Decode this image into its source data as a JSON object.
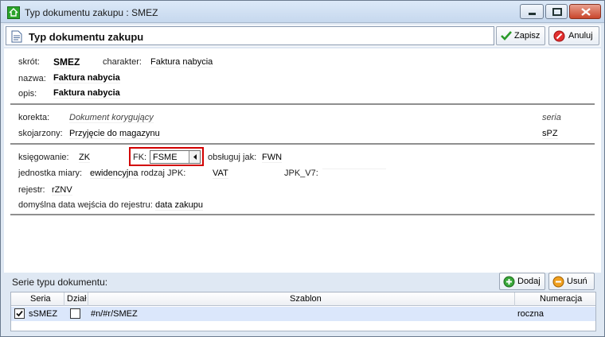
{
  "window": {
    "title": "Typ dokumentu zakupu : SMEZ"
  },
  "header": {
    "title": "Typ dokumentu zakupu",
    "save_label": "Zapisz",
    "cancel_label": "Anuluj"
  },
  "form": {
    "skrot_label": "skrót:",
    "skrot_value": "SMEZ",
    "charakter_label": "charakter:",
    "charakter_value": "Faktura nabycia",
    "nazwa_label": "nazwa:",
    "nazwa_value": "Faktura nabycia",
    "opis_label": "opis:",
    "opis_value": "Faktura nabycia",
    "korekta_label": "korekta:",
    "korekta_value": "Dokument korygujący",
    "seria_label": "seria",
    "skojarzony_label": "skojarzony:",
    "skojarzony_value": "Przyjęcie do magazynu",
    "skojarzony_seria": "sPZ",
    "ksiegowanie_label": "księgowanie:",
    "ksiegowanie_value": "ZK",
    "fk_label": "FK:",
    "fk_value": "FSME",
    "obsluguj_label": "obsługuj jak:",
    "obsluguj_value": "FWN",
    "jednostka_label": "jednostka miary:",
    "jednostka_value": "ewidencyjna",
    "rodzaj_label": "rodzaj JPK:",
    "rodzaj_value": "VAT",
    "jpk_label": "JPK_V7:",
    "jpk_value": "",
    "rejestr_label": "rejestr:",
    "rejestr_value": "rZNV",
    "domyslna_label": "domyślna data wejścia do rejestru:",
    "domyslna_value": "data zakupu"
  },
  "series": {
    "title": "Serie typu dokumentu:",
    "add_label": "Dodaj",
    "remove_label": "Usuń",
    "columns": {
      "seria": "Seria",
      "dzial": "Dział",
      "szablon": "Szablon",
      "numeracja": "Numeracja"
    },
    "rows": [
      {
        "seria": "sSMEZ",
        "szablon": "#n/#r/SMEZ",
        "numeracja": "roczna",
        "checked": true,
        "dzial_checked": false
      }
    ]
  },
  "colors": {
    "accent": "#d20000",
    "selection": "#dbe7fb"
  }
}
